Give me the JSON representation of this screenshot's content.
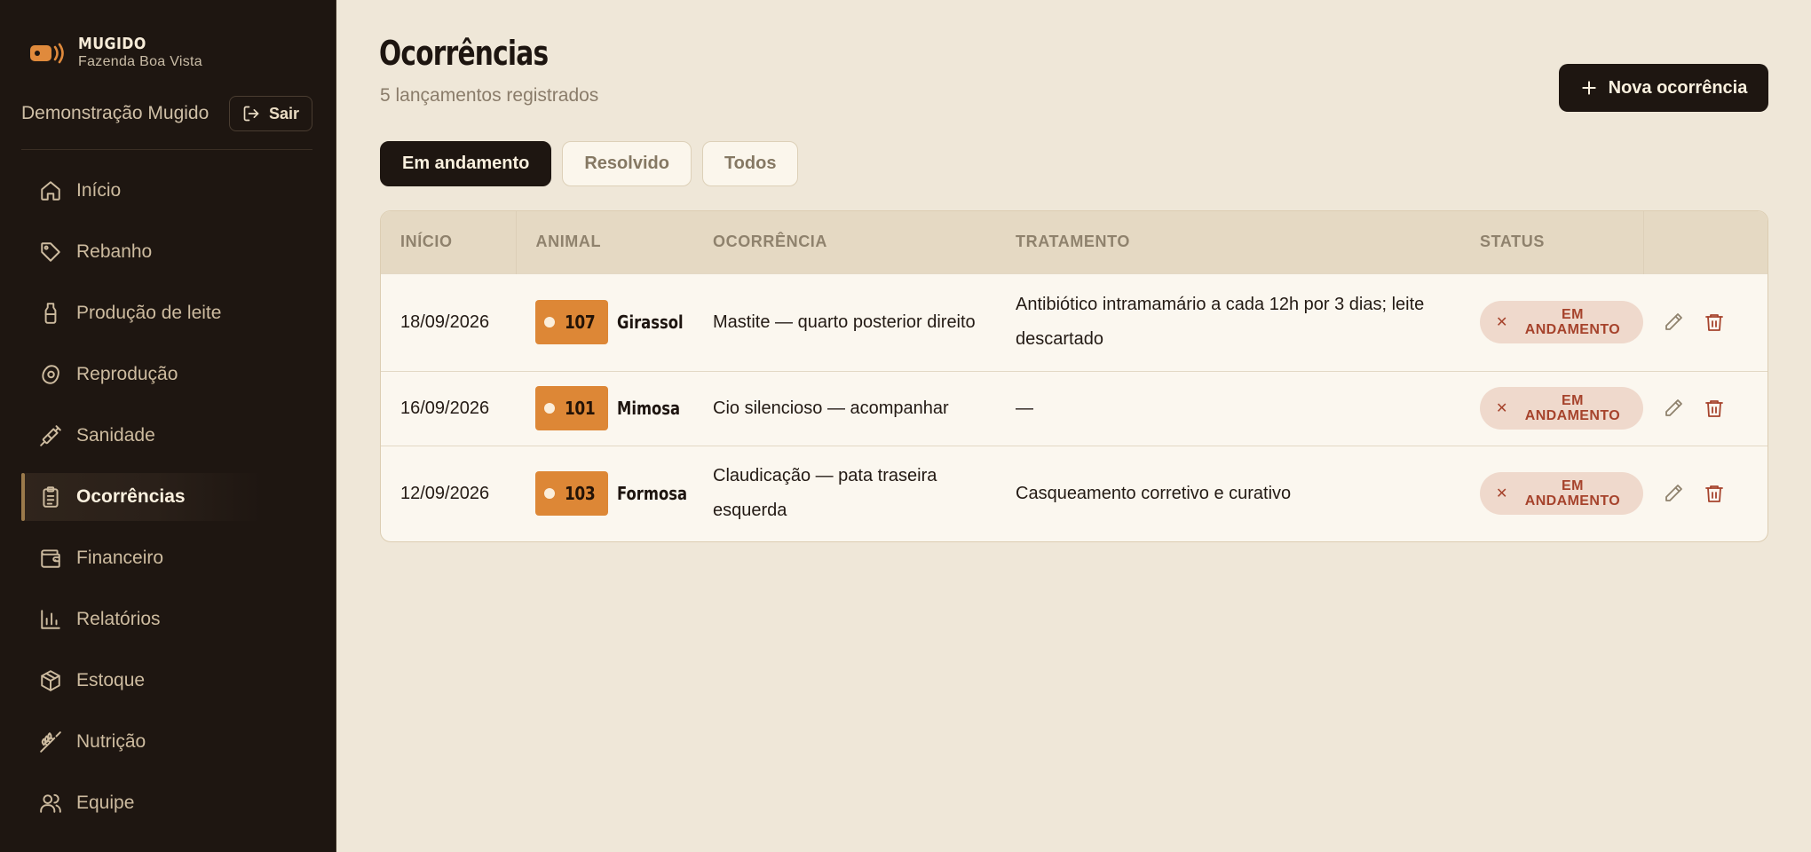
{
  "brand": {
    "name": "MUGIDO",
    "farm": "Fazenda Boa Vista"
  },
  "user": {
    "name": "Demonstração Mugido",
    "logout_label": "Sair"
  },
  "nav": [
    {
      "label": "Início",
      "icon": "home-icon"
    },
    {
      "label": "Rebanho",
      "icon": "tag-icon"
    },
    {
      "label": "Produção de leite",
      "icon": "milk-bottle-icon"
    },
    {
      "label": "Reprodução",
      "icon": "egg-icon"
    },
    {
      "label": "Sanidade",
      "icon": "syringe-icon"
    },
    {
      "label": "Ocorrências",
      "icon": "clipboard-icon",
      "active": true
    },
    {
      "label": "Financeiro",
      "icon": "wallet-icon"
    },
    {
      "label": "Relatórios",
      "icon": "bar-chart-icon"
    },
    {
      "label": "Estoque",
      "icon": "box-icon"
    },
    {
      "label": "Nutrição",
      "icon": "wheat-icon"
    },
    {
      "label": "Equipe",
      "icon": "users-icon"
    }
  ],
  "header": {
    "title": "Ocorrências",
    "subtitle": "5 lançamentos registrados",
    "new_button": "Nova ocorrência"
  },
  "filters": [
    {
      "label": "Em andamento",
      "active": true
    },
    {
      "label": "Resolvido",
      "active": false
    },
    {
      "label": "Todos",
      "active": false
    }
  ],
  "table": {
    "columns": [
      "INÍCIO",
      "ANIMAL",
      "OCORRÊNCIA",
      "TRATAMENTO",
      "STATUS"
    ],
    "rows": [
      {
        "date": "18/09/2026",
        "tag": "107",
        "animal": "Girassol",
        "occurrence": "Mastite — quarto posterior direito",
        "treatment": "Antibiótico intramamário a cada 12h por 3 dias; leite descartado",
        "status": "EM ANDAMENTO"
      },
      {
        "date": "16/09/2026",
        "tag": "101",
        "animal": "Mimosa",
        "occurrence": "Cio silencioso — acompanhar",
        "treatment": "—",
        "status": "EM ANDAMENTO"
      },
      {
        "date": "12/09/2026",
        "tag": "103",
        "animal": "Formosa",
        "occurrence": "Claudicação — pata traseira esquerda",
        "treatment": "Casqueamento corretivo e curativo",
        "status": "EM ANDAMENTO"
      }
    ]
  },
  "colors": {
    "sidebar_bg": "#1e1611",
    "page_bg": "#efe7d8",
    "accent_tag": "#dd8736",
    "status_bg": "#efd9cc",
    "status_text": "#a6432c"
  }
}
